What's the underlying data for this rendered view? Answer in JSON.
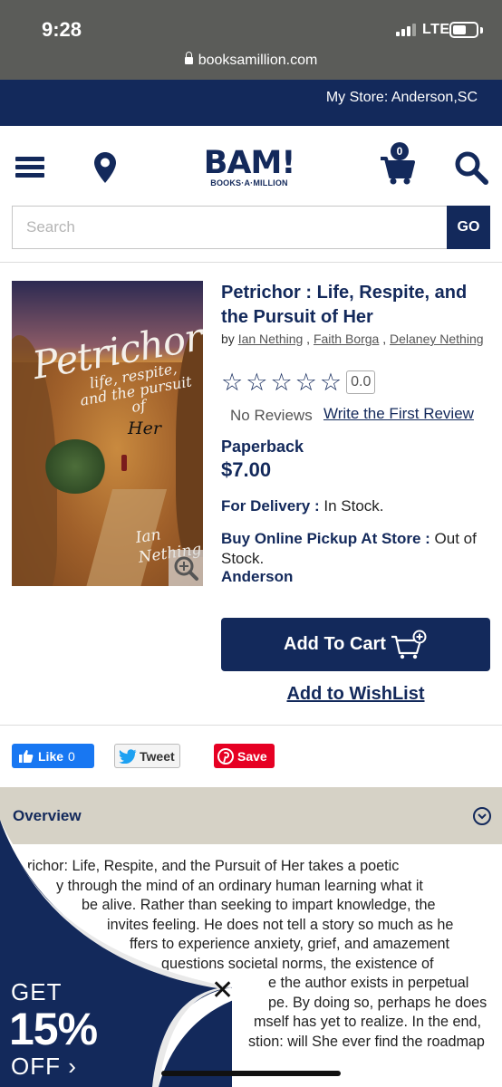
{
  "status_bar": {
    "time": "9:28",
    "network": "LTE"
  },
  "browser": {
    "url": "booksamillion.com"
  },
  "store_bar": {
    "label": "My Store: Anderson,SC"
  },
  "header": {
    "logo_main": "BAM!",
    "logo_sub": "BOOKS·A·MILLION",
    "cart_count": "0",
    "icons": [
      "menu-icon",
      "location-pin-icon",
      "cart-icon",
      "search-icon"
    ]
  },
  "search": {
    "placeholder": "Search",
    "button_label": "GO"
  },
  "product": {
    "title": "Petrichor : Life, Respite, and the Pursuit of Her",
    "by_label": "by",
    "authors": [
      "Ian Nething",
      "Faith Borga",
      "Delaney Nething"
    ],
    "rating_value": "0.0",
    "stars_filled": 0,
    "stars_total": 5,
    "no_reviews": "No Reviews",
    "write_review": "Write the First Review",
    "format": "Paperback",
    "price": "$7.00",
    "delivery_label": "For Delivery :",
    "delivery_status": " In Stock.",
    "pickup_label": "Buy Online Pickup At Store :",
    "pickup_status": " Out of Stock.",
    "pickup_store": "Anderson",
    "add_to_cart": "Add To Cart",
    "add_to_wishlist": "Add to WishList",
    "cover": {
      "title": "Petrichor:",
      "subtitle": "life, respite, and the pursuit of",
      "subtitle_end": "Her",
      "author": "Ian Nething"
    }
  },
  "social": {
    "like_label": "Like",
    "like_count": "0",
    "tweet_label": "Tweet",
    "save_label": "Save"
  },
  "overview": {
    "heading": "Overview",
    "lines": [
      "richor: Life, Respite, and the Pursuit of Her takes a poetic",
      "y through the mind of an ordinary human learning what it",
      "be alive. Rather than seeking to impart knowledge, the",
      "invites feeling. He does not tell a story so much as he",
      "ffers to experience anxiety, grief, and amazement",
      "questions societal norms, the existence of",
      "e the author exists in perpetual",
      "pe. By doing so, perhaps he does",
      "mself has yet to realize. In the end,",
      "stion: will She ever find the roadmap"
    ]
  },
  "promo": {
    "line1": "GET",
    "line2": "15%",
    "line3": "OFF ›",
    "close": "✕",
    "color": "#13295b"
  },
  "colors": {
    "brand_navy": "#13295b",
    "status_bar": "#5b5c59",
    "overview_bg": "#d6d2c6"
  }
}
